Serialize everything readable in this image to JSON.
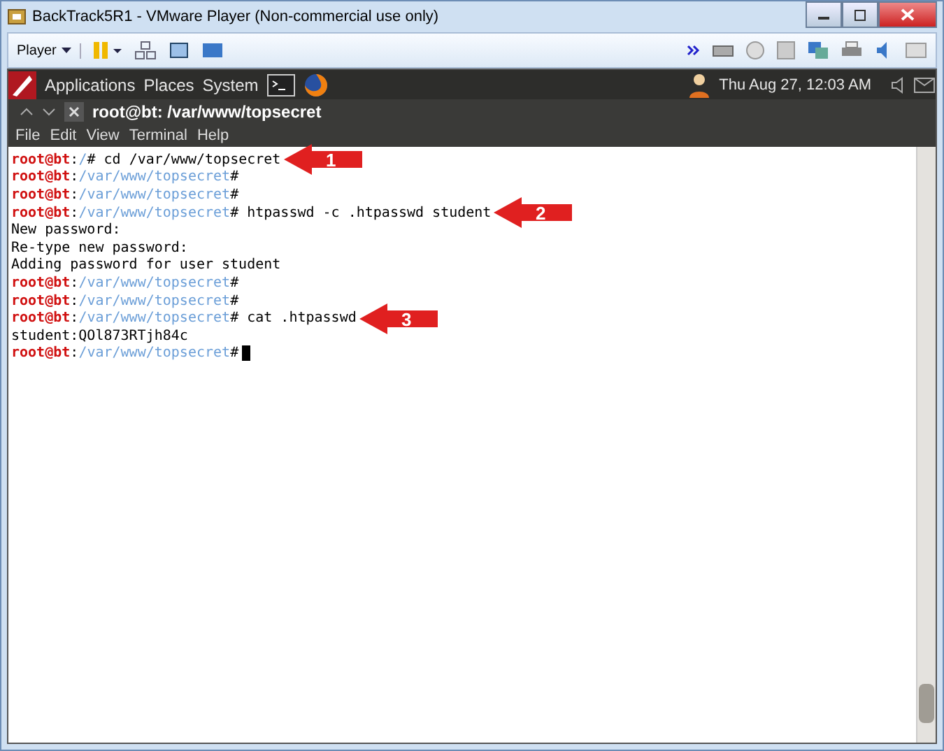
{
  "window": {
    "title": "BackTrack5R1 - VMware Player (Non-commercial use only)"
  },
  "toolbar": {
    "player_menu": "Player"
  },
  "panel": {
    "menus": [
      "Applications",
      "Places",
      "System"
    ],
    "clock": "Thu Aug 27, 12:03 AM"
  },
  "terminal": {
    "title": "root@bt: /var/www/topsecret",
    "menu": [
      "File",
      "Edit",
      "View",
      "Terminal",
      "Help"
    ],
    "lines": [
      {
        "kind": "prompt",
        "user": "root@bt",
        "sep": ":",
        "path": "/",
        "sign": "#",
        "command": "cd /var/www/topsecret",
        "callout": "1"
      },
      {
        "kind": "prompt",
        "user": "root@bt",
        "sep": ":",
        "path": "/var/www/topsecret",
        "sign": "#"
      },
      {
        "kind": "prompt",
        "user": "root@bt",
        "sep": ":",
        "path": "/var/www/topsecret",
        "sign": "#"
      },
      {
        "kind": "prompt",
        "user": "root@bt",
        "sep": ":",
        "path": "/var/www/topsecret",
        "sign": "#",
        "command": "htpasswd -c .htpasswd student",
        "callout": "2"
      },
      {
        "kind": "output",
        "text": "New password:"
      },
      {
        "kind": "output",
        "text": "Re-type new password:"
      },
      {
        "kind": "output",
        "text": "Adding password for user student"
      },
      {
        "kind": "prompt",
        "user": "root@bt",
        "sep": ":",
        "path": "/var/www/topsecret",
        "sign": "#"
      },
      {
        "kind": "prompt",
        "user": "root@bt",
        "sep": ":",
        "path": "/var/www/topsecret",
        "sign": "#"
      },
      {
        "kind": "prompt",
        "user": "root@bt",
        "sep": ":",
        "path": "/var/www/topsecret",
        "sign": "#",
        "command": "cat .htpasswd",
        "callout": "3"
      },
      {
        "kind": "output",
        "text": "student:QOl873RTjh84c"
      },
      {
        "kind": "prompt",
        "user": "root@bt",
        "sep": ":",
        "path": "/var/www/topsecret",
        "sign": "#",
        "cursor": true
      }
    ]
  }
}
